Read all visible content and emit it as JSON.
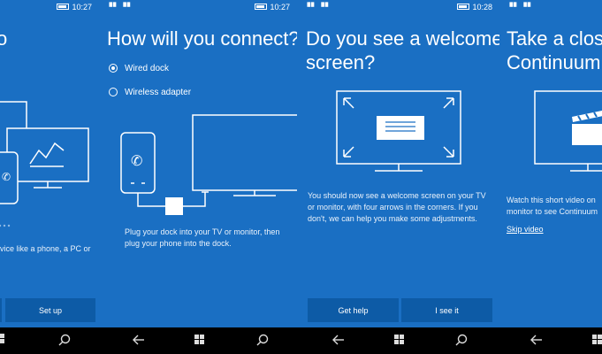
{
  "panels": [
    {
      "time": "10:27",
      "title_partial": "o",
      "description_partial": "vice like a phone, a PC or",
      "setup_button": "Set up"
    },
    {
      "time": "10:27",
      "title": "How will you connect?",
      "options": [
        "Wired dock",
        "Wireless adapter"
      ],
      "selected": "Wired dock",
      "description": [
        "Plug your dock into your TV or monitor, then",
        "plug your phone into the dock."
      ]
    },
    {
      "time": "10:28",
      "title_lines": [
        "Do you see a welcome",
        "screen?"
      ],
      "description": [
        "You should now see a welcome screen on your TV",
        "or monitor, with four arrows in the corners. If you",
        "don't, we can help you make some adjustments."
      ],
      "buttons": [
        "Get help",
        "I see it"
      ]
    },
    {
      "title_lines": [
        "Take a closer",
        "Continuum"
      ],
      "description": [
        "Watch this short video on",
        "monitor to see Continuum"
      ],
      "skip_link": "Skip video"
    }
  ],
  "nav": {
    "back": "back-arrow",
    "home": "windows-logo",
    "search": "search-icon"
  },
  "colors": {
    "panel_bg": "#1a6fc3",
    "button_bg": "#0d5ba6",
    "navbar": "#000000"
  }
}
